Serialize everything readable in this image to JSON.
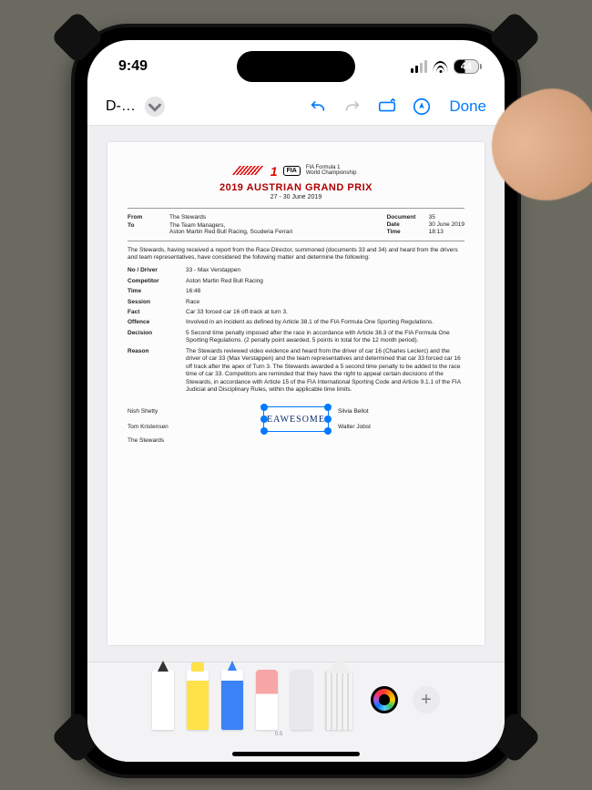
{
  "status": {
    "time": "9:49",
    "battery": "44"
  },
  "toolbar": {
    "title": "D-…",
    "done": "Done"
  },
  "doc": {
    "brand": {
      "f1": "1",
      "fia": "FIA",
      "champ1": "FIA Formula 1",
      "champ2": "World Championship"
    },
    "title": "2019 AUSTRIAN GRAND PRIX",
    "dates": "27 - 30 June 2019",
    "meta_left": {
      "from_k": "From",
      "from_v": "The Stewards",
      "to_k": "To",
      "to_v1": "The Team Managers,",
      "to_v2": "Aston Martin Red Bull Racing, Scuderia Ferrari"
    },
    "meta_right": {
      "document_k": "Document",
      "document_v": "35",
      "date_k": "Date",
      "date_v": "30 June 2019",
      "time_k": "Time",
      "time_v": "18:13"
    },
    "intro": "The Stewards, having received a report from the Race Director, summoned (documents 33 and 34) and heard from the drivers and team representatives, have considered the following matter and determine the following:",
    "fields": {
      "no_driver_k": "No / Driver",
      "no_driver_v": "33 - Max Verstappen",
      "competitor_k": "Competitor",
      "competitor_v": "Aston Martin Red Bull Racing",
      "time_k": "Time",
      "time_v": "16:48",
      "session_k": "Session",
      "session_v": "Race",
      "fact_k": "Fact",
      "fact_v": "Car 33 forced car 16 off-track at turn 3.",
      "offence_k": "Offence",
      "offence_v": "Involved in an incident as defined by Article 38.1 of the FIA Formula One Sporting Regulations.",
      "decision_k": "Decision",
      "decision_v": "5 Second time penalty imposed after the race in accordance with Article 38.3 of the FIA Formula One Sporting Regulations. (2 penalty point awarded, 5 points in total for the 12 month period).",
      "reason_k": "Reason",
      "reason_v": "The Stewards reviewed video evidence and heard from the driver of car 16 (Charles Leclerc) and the driver of car 33 (Max Verstappen) and the team representatives and determined that car 33 forced car 16 off track after the apex of Turn 3. The Stewards awarded a 5 second time penalty to be added to the race time of car 33. Competitors are reminded that they have the right to appeal certain decisions of the Stewards, in accordance with Article 15 of the FIA International Sporting Code and Article 9.1.1 of the FIA Judicial and Disciplinary Rules, within the applicable time limits."
    },
    "annotation": "EAWESOME",
    "sign": {
      "l1": "Nish Shetty",
      "r1": "Silvia Bellot",
      "l2": "Tom Kristensen",
      "r2": "Walter Jobst",
      "stewards": "The Stewards"
    }
  },
  "tray": {
    "pen_size": "",
    "marker_size": "",
    "pencil_size": "0.5",
    "eraser": "",
    "lasso": "",
    "ruler": ""
  }
}
